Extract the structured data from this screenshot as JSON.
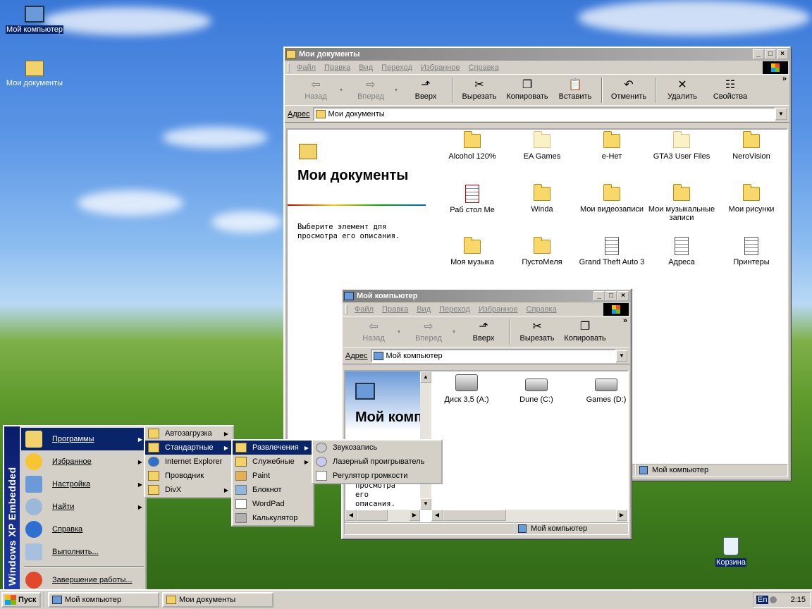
{
  "desktop": {
    "icons": [
      {
        "label": "Мой компьютер"
      },
      {
        "label": "Мои документы"
      },
      {
        "label": "Корзина"
      }
    ]
  },
  "docs_window": {
    "title": "Мои документы",
    "menu": [
      "Файл",
      "Правка",
      "Вид",
      "Переход",
      "Избранное",
      "Справка"
    ],
    "toolbar": [
      "Назад",
      "Вперед",
      "Вверх",
      "Вырезать",
      "Копировать",
      "Вставить",
      "Отменить",
      "Удалить",
      "Свойства"
    ],
    "more": "»",
    "address_label": "Адрес",
    "address_value": "Мои документы",
    "panel_title": "Мои документы",
    "panel_hint": "Выберите элемент для просмотра его описания.",
    "items": [
      "Alcohol 120%",
      "EA Games",
      "e-Нет",
      "GTA3 User Files",
      "NeroVision",
      "Раб стол Me",
      "Winda",
      "Мои видеозаписи",
      "Мои музыкальные записи",
      "Мои рисунки",
      "Моя музыка",
      "ПустоМеля",
      "Grand Theft Auto 3",
      "Адреса",
      "Принтеры"
    ],
    "status": "Мой компьютер"
  },
  "pc_window": {
    "title": "Мой компьютер",
    "menu": [
      "Файл",
      "Правка",
      "Вид",
      "Переход",
      "Избранное",
      "Справка"
    ],
    "toolbar": [
      "Назад",
      "Вперед",
      "Вверх",
      "Вырезать",
      "Копировать"
    ],
    "more": "»",
    "address_label": "Адрес",
    "address_value": "Мой компьютер",
    "panel_title": "Мой компь",
    "panel_hint": "просмотра его описания.",
    "items": [
      "Диск 3,5 (A:)",
      "Dune (C:)",
      "Games (D:)"
    ],
    "status": "Мой компьютер"
  },
  "start_menu": {
    "band": "Windows XP Embedded",
    "items": [
      "Программы",
      "Избранное",
      "Настройка",
      "Найти",
      "Справка",
      "Выполнить...",
      "Завершение работы..."
    ]
  },
  "sub_programs": [
    "Автозагрузка",
    "Стандартные",
    "Internet Explorer",
    "Проводник",
    "DivX"
  ],
  "sub_standard": [
    "Развлечения",
    "Служебные",
    "Paint",
    "Блокнот",
    "WordPad",
    "Калькулятор"
  ],
  "sub_fun": [
    "Звукозапись",
    "Лазерный проигрыватель",
    "Регулятор громкости"
  ],
  "taskbar": {
    "start": "Пуск",
    "tasks": [
      "Мой компьютер",
      "Мои документы"
    ],
    "lang": "En",
    "clock": "2:15"
  },
  "colors": {
    "title_active": "#0a246a",
    "face": "#d4d0c8"
  }
}
